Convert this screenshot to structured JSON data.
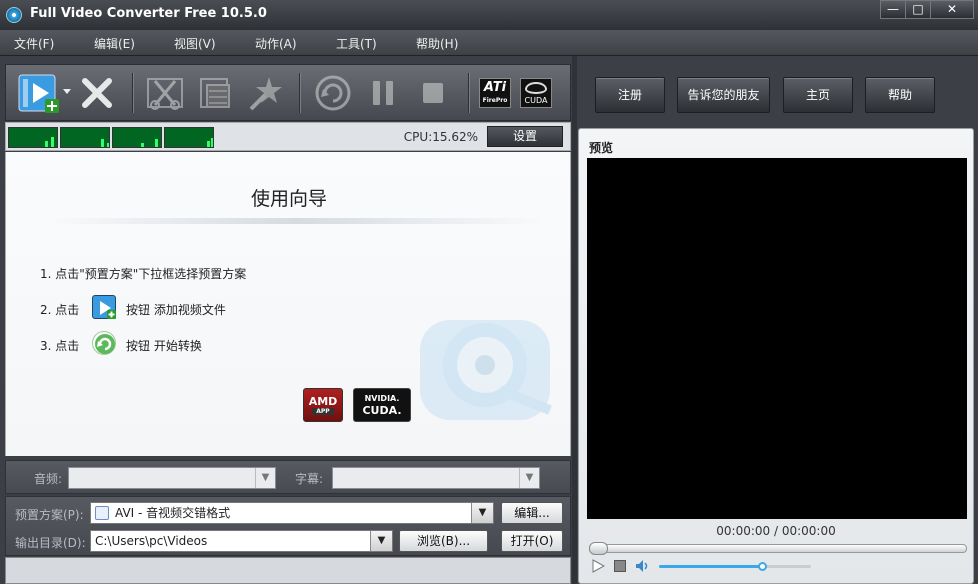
{
  "window": {
    "title": "Full Video Converter Free 10.5.0",
    "min_glyph": "—",
    "max_glyph": "□",
    "close_glyph": "✕"
  },
  "menu": [
    "文件(F)",
    "编辑(E)",
    "视图(V)",
    "动作(A)",
    "工具(T)",
    "帮助(H)"
  ],
  "toolbar": {
    "icons": [
      "add-video-icon",
      "remove-icon",
      "cut-icon",
      "merge-icon",
      "effect-icon",
      "convert-icon",
      "pause-icon",
      "stop-icon",
      "ati-firepro-icon",
      "nvidia-cuda-icon"
    ],
    "ati_text": "ATi",
    "ati_sub": "FirePro",
    "cuda_text": "CUDA"
  },
  "status": {
    "cpu": "CPU:15.62%",
    "settings_label": "设置"
  },
  "guide": {
    "title": "使用向导",
    "step1": "1. 点击\"预置方案\"下拉框选择预置方案",
    "step2_prefix": "2. 点击",
    "step2_suffix": "按钮  添加视频文件",
    "step3_prefix": "3. 点击",
    "step3_suffix": "按钮  开始转换",
    "amd_text": "AMD",
    "amd_sub": "APP",
    "nvidia_text": "NVIDIA.",
    "nvidia_sub": "CUDA."
  },
  "audio": {
    "label": "音频:",
    "value": ""
  },
  "subtitle": {
    "label": "字幕:",
    "value": ""
  },
  "preset": {
    "label": "预置方案(P):",
    "value": "AVI - 音视频交错格式",
    "edit_button": "编辑..."
  },
  "output": {
    "label": "输出目录(D):",
    "value": "C:\\Users\\pc\\Videos",
    "browse_button": "浏览(B)...",
    "open_button": "打开(O)"
  },
  "top_buttons": [
    "注册",
    "告诉您的朋友",
    "主页",
    "帮助"
  ],
  "preview": {
    "label": "预览",
    "time": "00:00:00 / 00:00:00",
    "volume": 0.68,
    "seek": 0.0
  },
  "colors": {
    "accent": "#3aa8e8",
    "screen": "#000000",
    "meter": "#33ff66"
  }
}
